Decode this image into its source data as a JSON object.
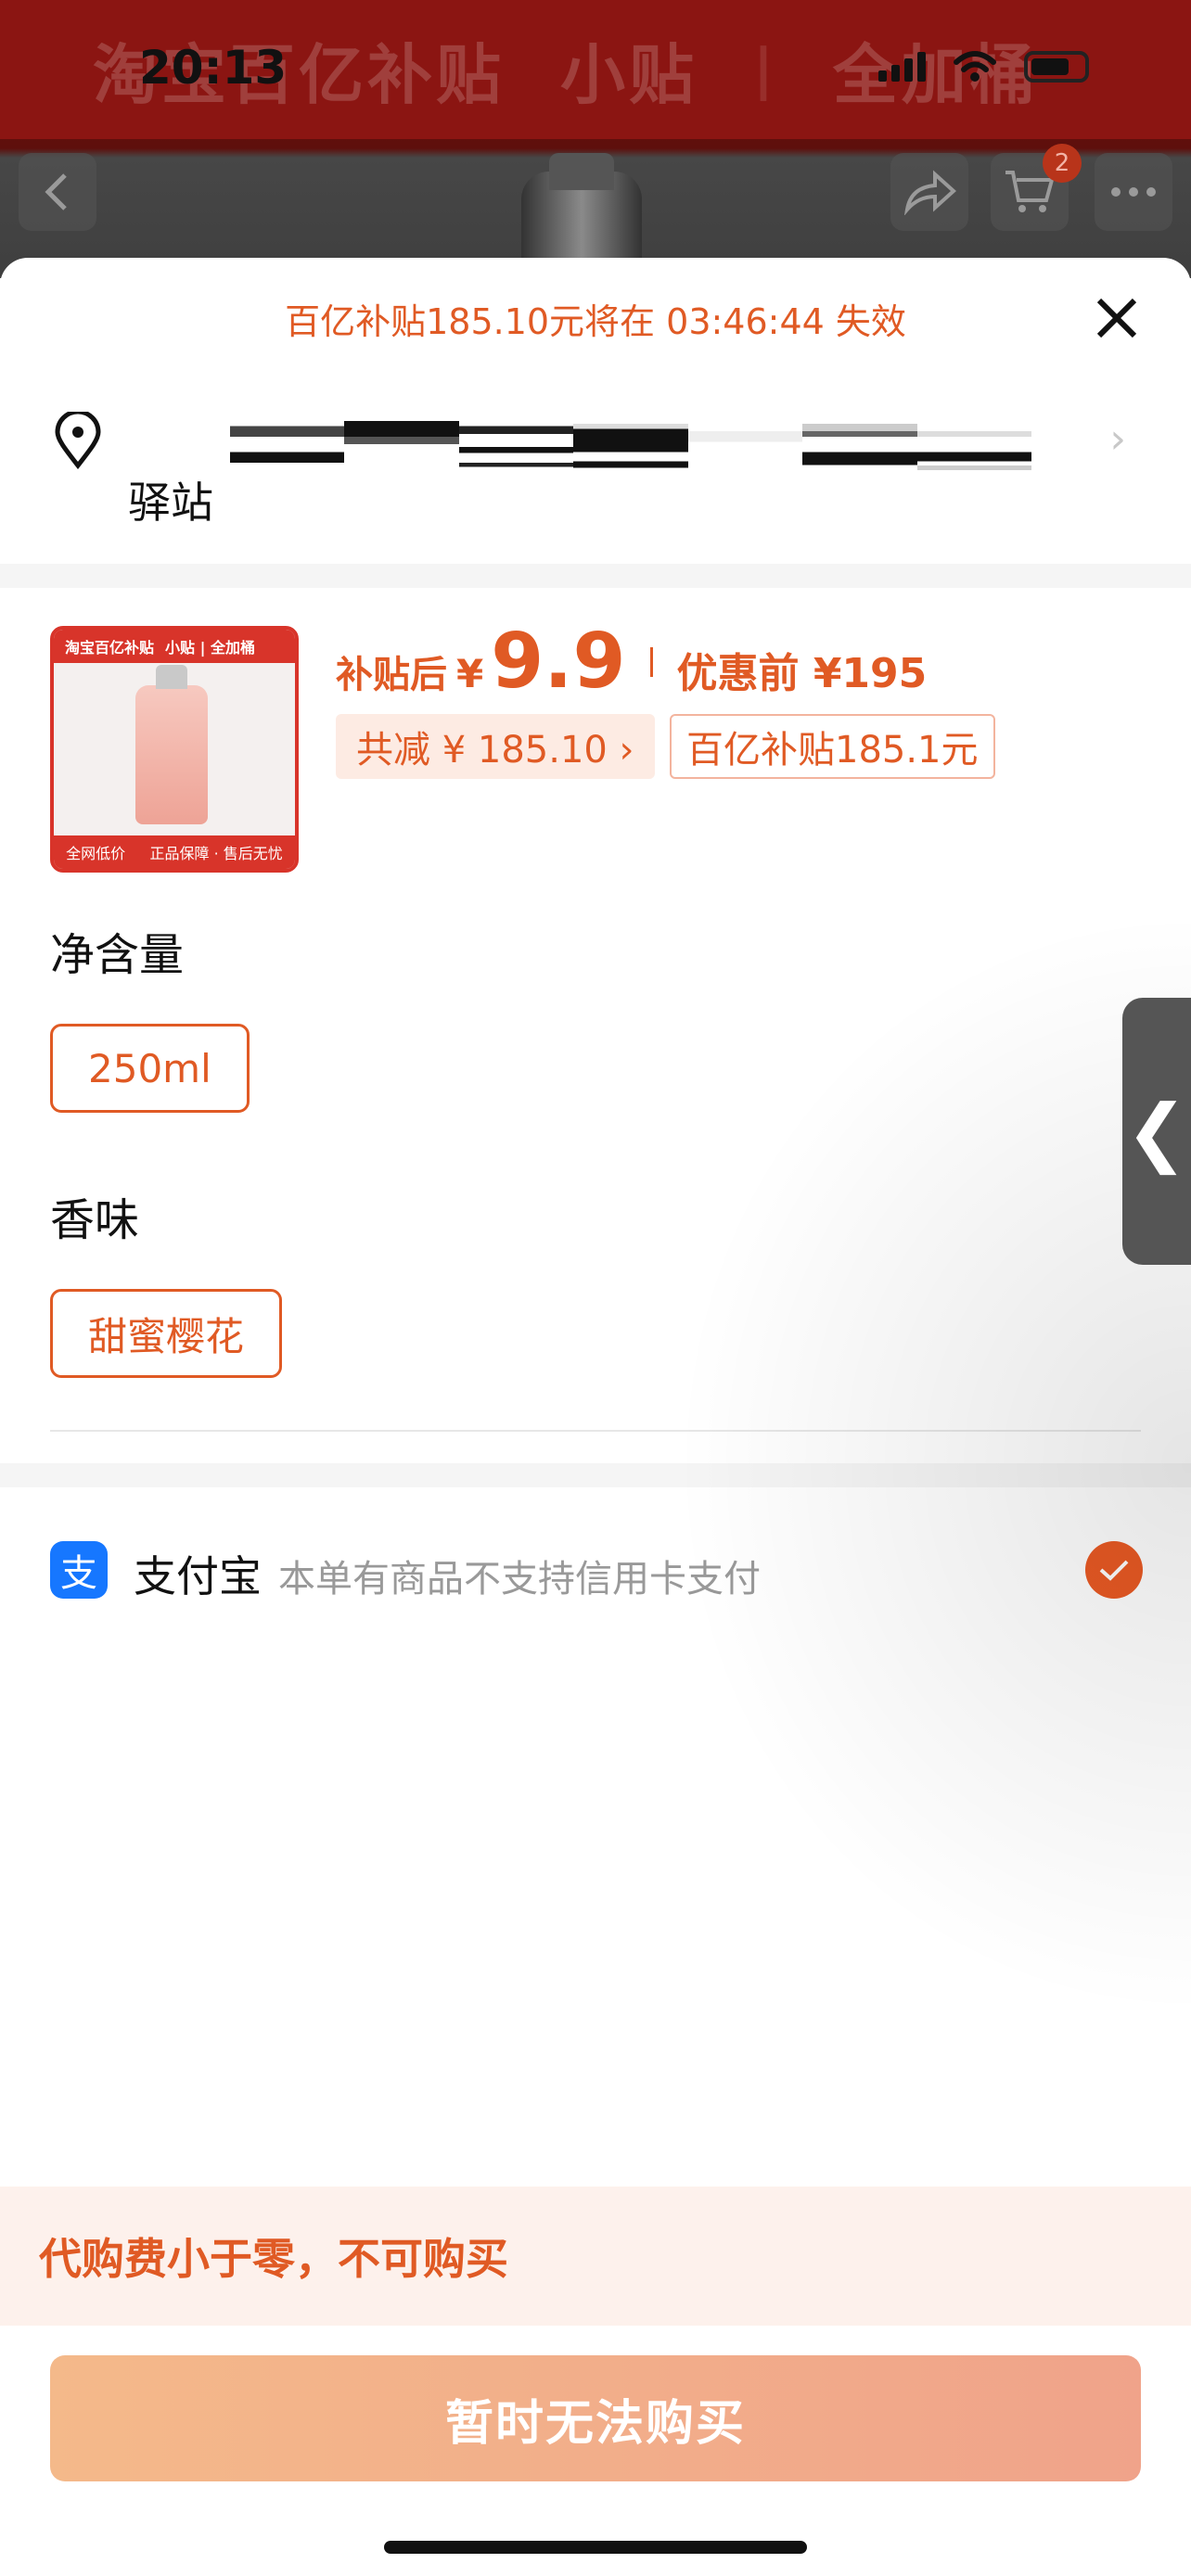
{
  "status_bar": {
    "time": "20:13"
  },
  "banner": {
    "left_text": "淘宝百亿补贴",
    "mid_text": "小贴",
    "right_text": "全加桶"
  },
  "nav": {
    "cart_count": "2"
  },
  "sheet": {
    "countdown": "百亿补贴185.10元将在 03:46:44 失效",
    "address": {
      "label": "驿站",
      "icon": "location-pin-icon"
    },
    "product": {
      "thumb_header_left": "淘宝百亿补贴",
      "thumb_header_right": "小贴 | 全加桶",
      "thumb_footer_left": "全网低价",
      "thumb_footer_right": "正品保障 · 售后无忧",
      "after_label": "补贴后",
      "yen": "¥",
      "price": "9.9",
      "before_label": "优惠前 ¥195",
      "total_tag": "共减 ¥ 185.10 ›",
      "subsidy_tag": "百亿补贴185.1元"
    },
    "options": [
      {
        "title": "净含量",
        "value": "250ml"
      },
      {
        "title": "香味",
        "value": "甜蜜樱花"
      }
    ],
    "payment": {
      "name": "支付宝",
      "note": "本单有商品不支持信用卡支付",
      "icon_glyph": "支",
      "selected": true
    },
    "warning": "代购费小于零，不可购买",
    "buy_button": "暂时无法购买",
    "side_tab_glyph": "❮"
  },
  "colors": {
    "accent": "#e05a24",
    "alipay_blue": "#1677ff",
    "button_gradient_start": "#f4b98a",
    "button_gradient_end": "#f0a38a"
  }
}
